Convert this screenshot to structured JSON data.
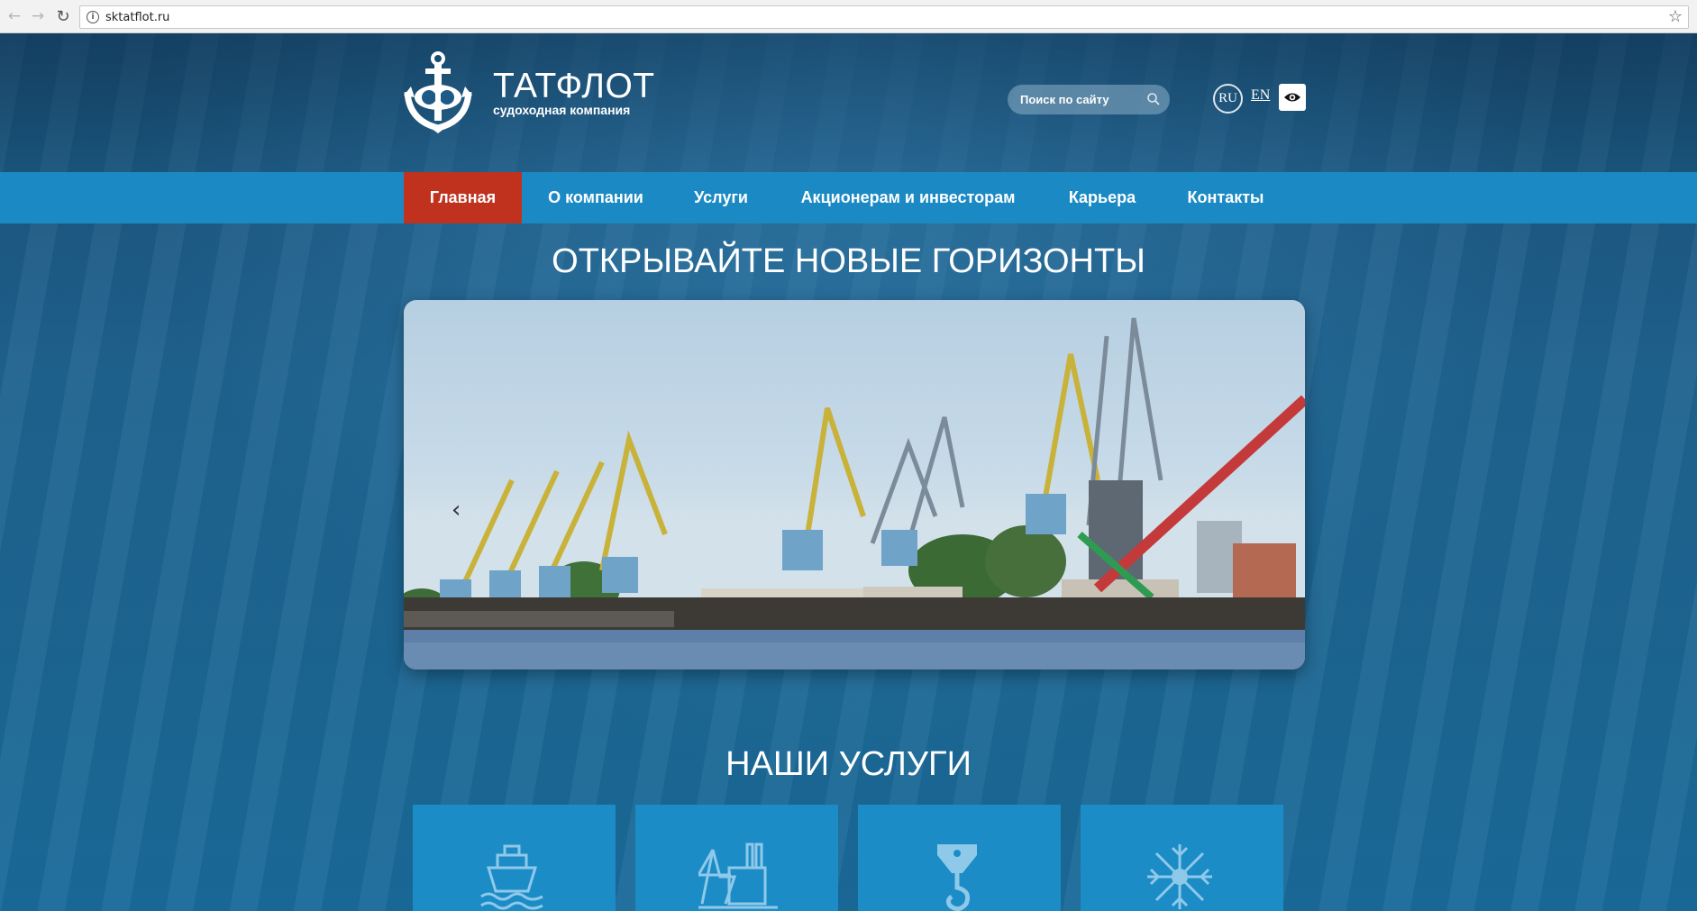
{
  "browser": {
    "url": "sktatflot.ru"
  },
  "header": {
    "logo_title": "ТАТФЛОТ",
    "logo_subtitle": "судоходная компания",
    "search_placeholder": "Поиск по сайту",
    "lang_ru": "RU",
    "lang_en": "EN"
  },
  "menu": {
    "items": [
      {
        "label": "Главная",
        "active": true
      },
      {
        "label": "О компании"
      },
      {
        "label": "Услуги"
      },
      {
        "label": "Акционерам и инвесторам"
      },
      {
        "label": "Карьера"
      },
      {
        "label": "Контакты"
      }
    ]
  },
  "hero": {
    "title": "ОТКРЫВАЙТЕ НОВЫЕ ГОРИЗОНТЫ",
    "prev_arrow": "‹"
  },
  "services": {
    "title": "НАШИ УСЛУГИ",
    "tiles": [
      {
        "icon": "ship-icon"
      },
      {
        "icon": "port-icon"
      },
      {
        "icon": "crane-hook-icon"
      },
      {
        "icon": "snowflake-icon"
      }
    ]
  },
  "colors": {
    "menu_bg": "#1b8ac4",
    "menu_active": "#c0321e",
    "tile_bg": "#1c8cc6"
  }
}
